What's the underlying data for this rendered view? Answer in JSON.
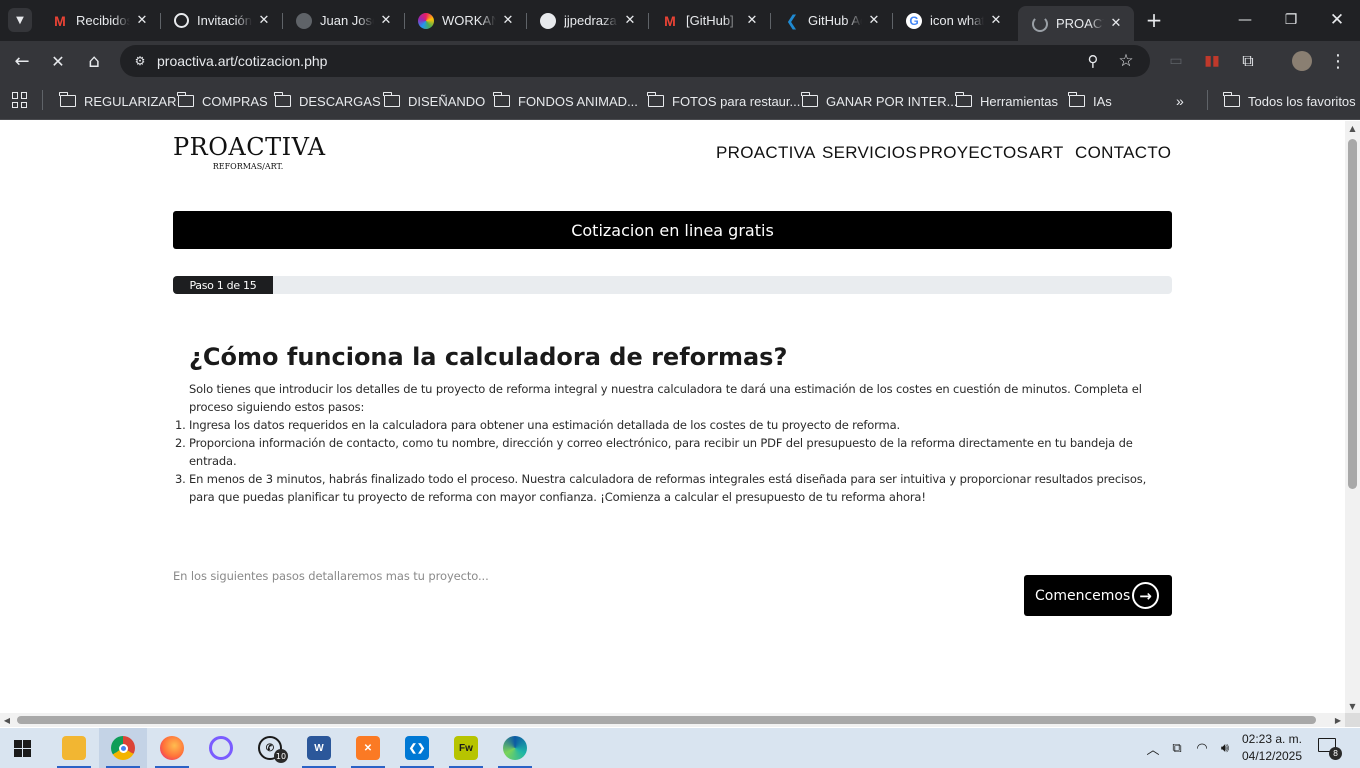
{
  "browser": {
    "tabs": [
      {
        "title": "Recibidos",
        "icon": "gmail-icon",
        "color": "#ea4335",
        "glyph": "M"
      },
      {
        "title": "Invitación",
        "icon": "chatgpt-icon",
        "color": "#202124",
        "glyph": "✺"
      },
      {
        "title": "Juan Jose",
        "icon": "globe-icon",
        "color": "#5f6368",
        "glyph": "◍"
      },
      {
        "title": "WORKANA",
        "icon": "workana-icon",
        "color": "#8e44ad",
        "glyph": "◉"
      },
      {
        "title": "jjpedraza",
        "icon": "github-icon",
        "color": "#202124",
        "glyph": "●"
      },
      {
        "title": "[GitHub]",
        "icon": "gmail-icon",
        "color": "#ea4335",
        "glyph": "M"
      },
      {
        "title": "GitHub Ac",
        "icon": "vscode-icon",
        "color": "#1f8ad2",
        "glyph": "❮"
      },
      {
        "title": "icon what",
        "icon": "google-icon",
        "color": "#ffffff",
        "glyph": "G"
      },
      {
        "title": "PROACTIV",
        "icon": "loading-icon",
        "color": "#5f6368",
        "glyph": "◌"
      }
    ],
    "url": "proactiva.art/cotizacion.php",
    "bookmarks": [
      "REGULARIZAR",
      "COMPRAS",
      "DESCARGAS",
      "DISEÑANDO",
      "FONDOS ANIMAD...",
      "FOTOS para restaur...",
      "GANAR POR INTER...",
      "Herramientas",
      "IAs"
    ],
    "all_bookmarks": "Todos los favoritos"
  },
  "site": {
    "logo": {
      "main": "PROACTIVA",
      "sub": "REFORMAS/ART."
    },
    "nav": [
      "PROACTIVA",
      "SERVICIOS",
      "PROYECTOS",
      "ART",
      "CONTACTO"
    ],
    "hero_title": "Cotizacion en linea gratis",
    "progress": {
      "label": "Paso 1 de 15",
      "current": 1,
      "total": 15,
      "fraction": 0.1
    },
    "heading": "¿Cómo funciona la calculadora de reformas?",
    "intro": "Solo tienes que introducir los detalles de tu proyecto de reforma integral y nuestra calculadora te dará una estimación de los costes en cuestión de minutos. Completa el proceso siguiendo estos pasos:",
    "steps": [
      "Ingresa los datos requeridos en la calculadora para obtener una estimación detallada de los costes de tu proyecto de reforma.",
      "Proporciona información de contacto, como tu nombre, dirección y correo electrónico, para recibir un PDF del presupuesto de la reforma directamente en tu bandeja de entrada.",
      "En menos de 3 minutos, habrás finalizado todo el proceso. Nuestra calculadora de reformas integrales está diseñada para ser intuitiva y proporcionar resultados precisos, para que puedas planificar tu proyecto de reforma con mayor confianza. ¡Comienza a calcular el presupuesto de tu reforma ahora!"
    ],
    "footnote": "En los siguientes pasos detallaremos mas tu proyecto...",
    "cta": "Comencemos"
  },
  "taskbar": {
    "whatsapp_badge": "10",
    "clock_time": "02:23 a. m.",
    "clock_date": "04/12/2025",
    "notification_count": "8"
  }
}
